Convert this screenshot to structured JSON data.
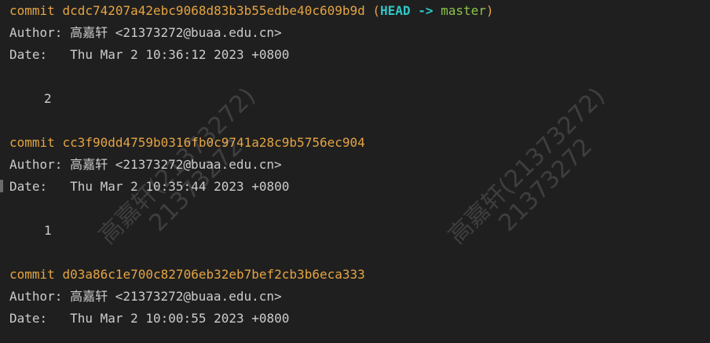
{
  "commits": [
    {
      "keyword": "commit",
      "hash": "dcdc74207a42ebc9068d83b3b55edbe40c609b9d",
      "refs": {
        "open": "(",
        "head": "HEAD",
        "arrow": "->",
        "branch": "master",
        "close": ")"
      },
      "author_line": "Author: 高嘉轩 <21373272@buaa.edu.cn>",
      "date_line": "Date:   Thu Mar 2 10:36:12 2023 +0800",
      "message": "2"
    },
    {
      "keyword": "commit",
      "hash": "cc3f90dd4759b0316fb0c9741a28c9b5756ec904",
      "author_line": "Author: 高嘉轩 <21373272@buaa.edu.cn>",
      "date_line": "Date:   Thu Mar 2 10:35:44 2023 +0800",
      "message": "1"
    },
    {
      "keyword": "commit",
      "hash": "d03a86c1e700c82706eb32eb7bef2cb3b6eca333",
      "author_line": "Author: 高嘉轩 <21373272@buaa.edu.cn>",
      "date_line": "Date:   Thu Mar 2 10:00:55 2023 +0800"
    }
  ],
  "watermark": {
    "name_line": "高嘉轩(21373272)",
    "id_line": "21373272"
  },
  "colors": {
    "background": "#1f1f1f",
    "text": "#cccccc",
    "commit": "#e5a442",
    "head": "#2fc7c7",
    "branch": "#8bc34a"
  }
}
